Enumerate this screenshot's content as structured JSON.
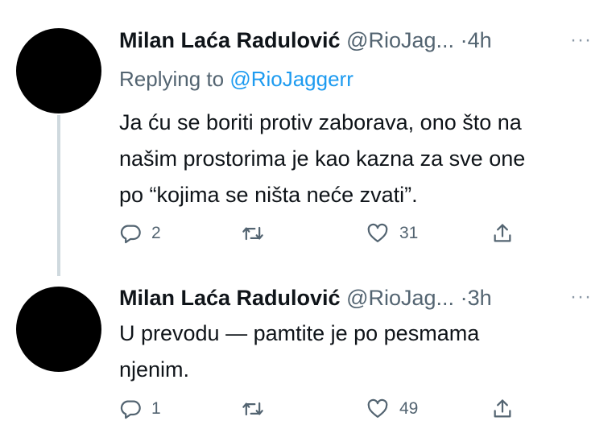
{
  "tweets": [
    {
      "author": "Milan Laća Radulović",
      "handle": "@RioJag...",
      "separator": "·",
      "time": "4h",
      "more": "···",
      "replying_prefix": "Replying to ",
      "replying_handle": "@RioJaggerr",
      "lines": [
        "Ja ću se boriti protiv zaborava, ono što na",
        "našim prostorima je kao kazna za sve one",
        "po “kojima se ništa neće zvati”."
      ],
      "replies": "2",
      "retweets": "",
      "likes": "31"
    },
    {
      "author": "Milan Laća Radulović",
      "handle": "@RioJag...",
      "separator": "·",
      "time": "3h",
      "more": "···",
      "lines": [
        "U prevodu — pamtite je po pesmama",
        "njenim."
      ],
      "replies": "1",
      "retweets": "",
      "likes": "49"
    }
  ],
  "icons": {
    "reply": "reply-icon",
    "retweet": "retweet-icon",
    "like": "heart-icon",
    "share": "share-icon",
    "more": "more-icon"
  },
  "colors": {
    "text": "#0f1419",
    "secondary": "#536471",
    "link": "#1d9bf0",
    "thread_line": "#cfd9de",
    "avatar": "#000000"
  }
}
